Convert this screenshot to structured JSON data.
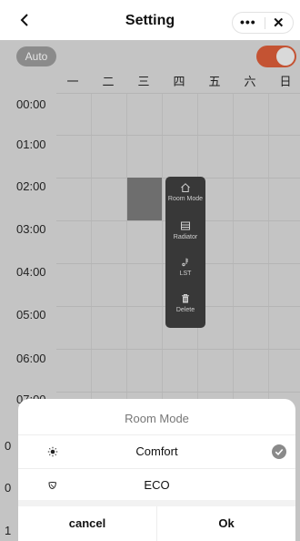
{
  "header": {
    "title": "Setting",
    "back_icon": "chevron-left-icon",
    "more_label": "•••",
    "close_label": "✕"
  },
  "scheduler": {
    "auto_label": "Auto",
    "mode_toggle_on": true,
    "toggle_color": "#c45333",
    "days": [
      "一",
      "二",
      "三",
      "四",
      "五",
      "六",
      "日"
    ],
    "times": [
      "00:00",
      "01:00",
      "02:00",
      "03:00",
      "04:00",
      "05:00",
      "06:00",
      "07:00"
    ],
    "cut_off_labels": [
      "0",
      "0",
      "1"
    ]
  },
  "popup_menu": {
    "items": [
      {
        "icon": "home-icon",
        "label": "Room Mode"
      },
      {
        "icon": "radiator-icon",
        "label": "Radiator"
      },
      {
        "icon": "lst-icon",
        "label": "LST"
      },
      {
        "icon": "trash-icon",
        "label": "Delete"
      }
    ]
  },
  "sheet": {
    "title": "Room Mode",
    "options": [
      {
        "icon": "sun-icon",
        "label": "Comfort",
        "selected": true
      },
      {
        "icon": "leaf-icon",
        "label": "ECO",
        "selected": false
      }
    ],
    "cancel_label": "cancel",
    "ok_label": "Ok"
  }
}
